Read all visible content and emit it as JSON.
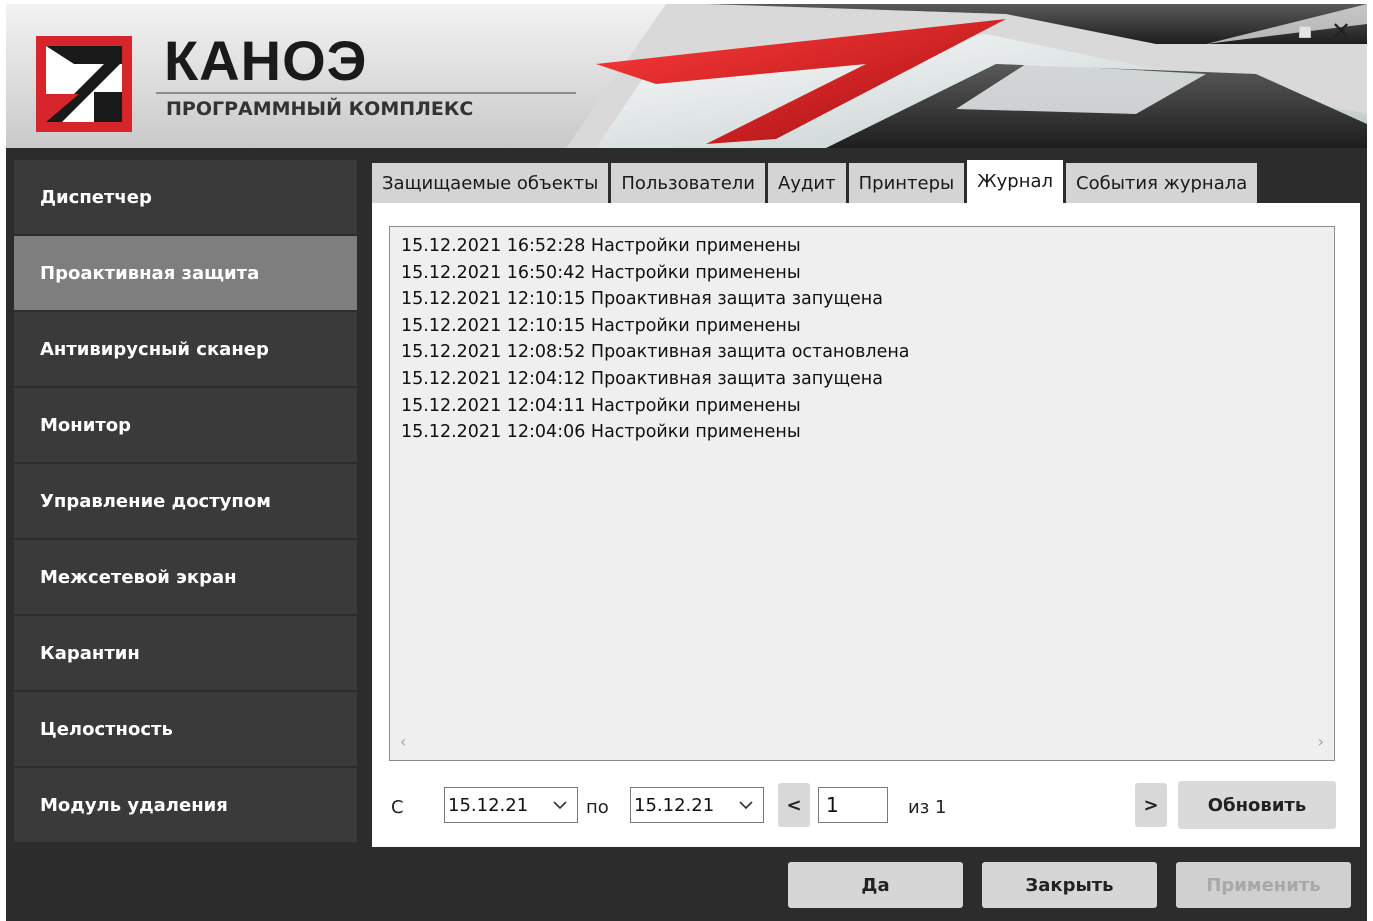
{
  "header": {
    "brand_title": "КАНОЭ",
    "brand_subtitle": "ПРОГРАММНЫЙ КОМПЛЕКС",
    "window_controls": {
      "minimize": "_",
      "close": "✕"
    }
  },
  "sidebar": {
    "items": [
      {
        "label": "Диспетчер",
        "active": false
      },
      {
        "label": "Проактивная защита",
        "active": true
      },
      {
        "label": "Антивирусный сканер",
        "active": false
      },
      {
        "label": "Монитор",
        "active": false
      },
      {
        "label": "Управление доступом",
        "active": false
      },
      {
        "label": "Межсетевой экран",
        "active": false
      },
      {
        "label": "Карантин",
        "active": false
      },
      {
        "label": "Целостность",
        "active": false
      },
      {
        "label": "Модуль удаления",
        "active": false
      }
    ]
  },
  "tabs": [
    {
      "label": "Защищаемые объекты",
      "active": false
    },
    {
      "label": "Пользователи",
      "active": false
    },
    {
      "label": "Аудит",
      "active": false
    },
    {
      "label": "Принтеры",
      "active": false
    },
    {
      "label": "Журнал",
      "active": true
    },
    {
      "label": "События журнала",
      "active": false
    }
  ],
  "log": {
    "lines": [
      "15.12.2021 16:52:28 Настройки применены",
      "15.12.2021 16:50:42 Настройки применены",
      "15.12.2021 12:10:15 Проактивная защита запущена",
      "15.12.2021 12:10:15 Настройки применены",
      "15.12.2021 12:08:52 Проактивная защита остановлена",
      "15.12.2021 12:04:12 Проактивная защита запущена",
      "15.12.2021 12:04:11 Настройки применены",
      "15.12.2021 12:04:06 Настройки применены"
    ]
  },
  "filter": {
    "from_label": "С",
    "from_date": "15.12.21",
    "to_label": "по",
    "to_date": "15.12.21",
    "prev_label": "<",
    "page_value": "1",
    "of_label": "из 1",
    "next_label": ">",
    "refresh_label": "Обновить"
  },
  "footer": {
    "ok_label": "Да",
    "close_label": "Закрыть",
    "apply_label": "Применить",
    "apply_enabled": false
  },
  "colors": {
    "accent_red": "#d7262b",
    "sidebar_bg": "#3a3a3a",
    "sidebar_active": "#7e7e7e",
    "window_bg": "#2c2c2c"
  }
}
